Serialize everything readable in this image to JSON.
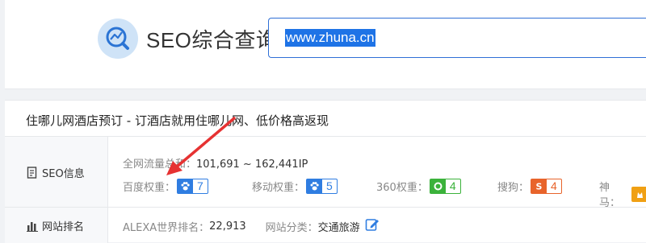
{
  "search": {
    "title": "SEO综合查询",
    "query": "www.zhuna.cn"
  },
  "result": {
    "site_title": "住哪儿网酒店预订 - 订酒店就用住哪儿网、低价格高返现",
    "seo_section": {
      "label": "SEO信息",
      "traffic_label": "全网流量总和：",
      "traffic_value": "101,691 ~ 162,441IP",
      "weights": [
        {
          "label": "百度权重：",
          "value": "7",
          "icon": "baidu-paw-icon",
          "color": "#2f7de1"
        },
        {
          "label": "移动权重：",
          "value": "5",
          "icon": "baidu-paw-icon",
          "color": "#2f7de1"
        },
        {
          "label": "360权重：",
          "value": "4",
          "icon": "360-icon",
          "color": "#3bb23b"
        },
        {
          "label": "搜狗：",
          "value": "4",
          "icon": "sogou-icon",
          "color": "#e8642b"
        },
        {
          "label": "神马：",
          "value": "",
          "icon": "shenma-icon",
          "color": "#f0a014"
        }
      ]
    },
    "rank_section": {
      "label": "网站排名",
      "alexa_label": "ALEXA世界排名：",
      "alexa_value": "22,913",
      "category_label": "网站分类：",
      "category_value": "交通旅游"
    }
  }
}
